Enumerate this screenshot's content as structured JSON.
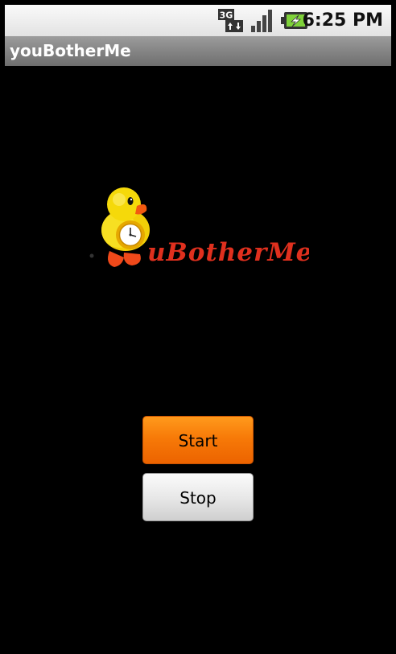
{
  "status_bar": {
    "time": "6:25 PM",
    "network_icon": "3g-data-icon",
    "signal_icon": "signal-strength-icon",
    "battery_icon": "battery-charging-icon"
  },
  "app": {
    "title": "youBotherMe"
  },
  "logo": {
    "text": "uBotherMe",
    "icon": "duck-alarm-clock-icon"
  },
  "buttons": {
    "start_label": "Start",
    "stop_label": "Stop"
  },
  "colors": {
    "background": "#000000",
    "start_button": "#f77a08",
    "stop_button": "#e8e8e8",
    "logo_text": "#e0301e",
    "duck": "#f5d90a"
  }
}
